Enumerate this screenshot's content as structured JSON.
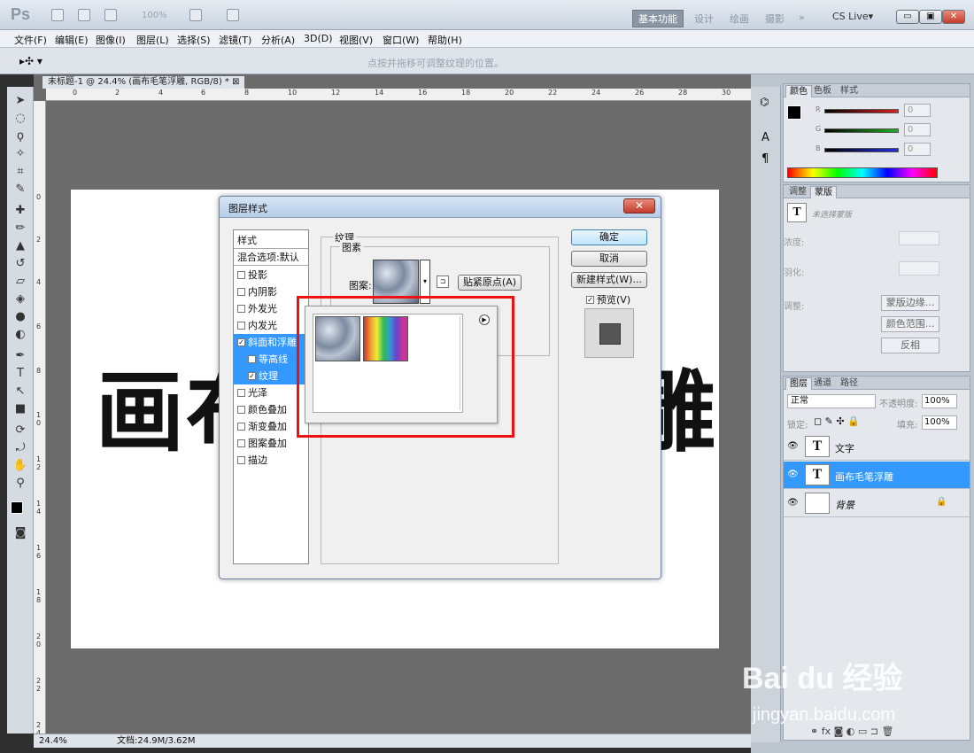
{
  "app": {
    "logo": "Ps",
    "zoom_display": "100%",
    "workspaces": {
      "active": "基本功能",
      "others": [
        "设计",
        "绘画",
        "摄影",
        "»"
      ]
    },
    "cs_live": "CS Live▾"
  },
  "menu": [
    "文件(F)",
    "编辑(E)",
    "图像(I)",
    "图层(L)",
    "选择(S)",
    "滤镜(T)",
    "分析(A)",
    "3D(D)",
    "视图(V)",
    "窗口(W)",
    "帮助(H)"
  ],
  "options_bar": {
    "hint": "点按并拖移可调整纹理的位置。"
  },
  "document": {
    "tab_title": "未标题-1 @ 24.4% (画布毛笔浮雕, RGB/8) * ⊠",
    "ruler_h": [
      "0",
      "2",
      "4",
      "6",
      "8",
      "10",
      "12",
      "14",
      "16",
      "18",
      "20",
      "22",
      "24",
      "26",
      "28",
      "30"
    ],
    "ruler_v": [
      "0",
      "2",
      "4",
      "6",
      "8",
      "1 0",
      "1 2",
      "1 4",
      "1 6",
      "1 8",
      "2 0",
      "2 2",
      "2 4"
    ],
    "canvas_text_left": "画布",
    "canvas_text_right": "雕",
    "status_zoom": "24.4%",
    "status_doc": "文档:24.9M/3.62M"
  },
  "dialog": {
    "title": "图层样式",
    "close": "✕",
    "styles_header": "样式",
    "blend_options": "混合选项:默认",
    "styles": [
      {
        "label": "投影",
        "checked": false
      },
      {
        "label": "内阴影",
        "checked": false
      },
      {
        "label": "外发光",
        "checked": false
      },
      {
        "label": "内发光",
        "checked": false
      },
      {
        "label": "斜面和浮雕",
        "checked": true
      },
      {
        "label": "等高线",
        "checked": false
      },
      {
        "label": "纹理",
        "checked": true
      },
      {
        "label": "光泽",
        "checked": false
      },
      {
        "label": "颜色叠加",
        "checked": false
      },
      {
        "label": "渐变叠加",
        "checked": false
      },
      {
        "label": "图案叠加",
        "checked": false
      },
      {
        "label": "描边",
        "checked": false
      }
    ],
    "texture_group": "纹理",
    "pattern_group": "图素",
    "pattern_label": "图案:",
    "snap_button": "贴紧原点(A)",
    "ok": "确定",
    "cancel": "取消",
    "new_style": "新建样式(W)...",
    "preview": "预览(V)",
    "check_mark": "✓"
  },
  "panels": {
    "color_tabs": [
      "颜色",
      "色板",
      "样式"
    ],
    "channels": [
      {
        "label": "R",
        "value": "0",
        "color": "#e02020"
      },
      {
        "label": "G",
        "value": "0",
        "color": "#20b020"
      },
      {
        "label": "B",
        "value": "0",
        "color": "#2030e0"
      }
    ],
    "adjust_tabs": [
      "调整",
      "蒙版"
    ],
    "mask_title": "未选择蒙版",
    "density": "浓度:",
    "feather": "羽化:",
    "refine": "调整:",
    "mask_buttons": [
      "蒙版边缘...",
      "颜色范围...",
      "反相"
    ],
    "layer_tabs": [
      "图层",
      "通道",
      "路径"
    ],
    "blend_mode": "正常",
    "opacity_label": "不透明度:",
    "opacity_value": "100%",
    "lock_label": "锁定:",
    "fill_label": "填充:",
    "fill_value": "100%",
    "layers": [
      {
        "name": "文字",
        "thumb": "T",
        "selected": false
      },
      {
        "name": "画布毛笔浮雕",
        "thumb": "T",
        "selected": true
      },
      {
        "name": "背景",
        "thumb": "",
        "selected": false
      }
    ]
  },
  "watermark": {
    "brand": "Bai du 经验",
    "url": "jingyan.baidu.com"
  }
}
